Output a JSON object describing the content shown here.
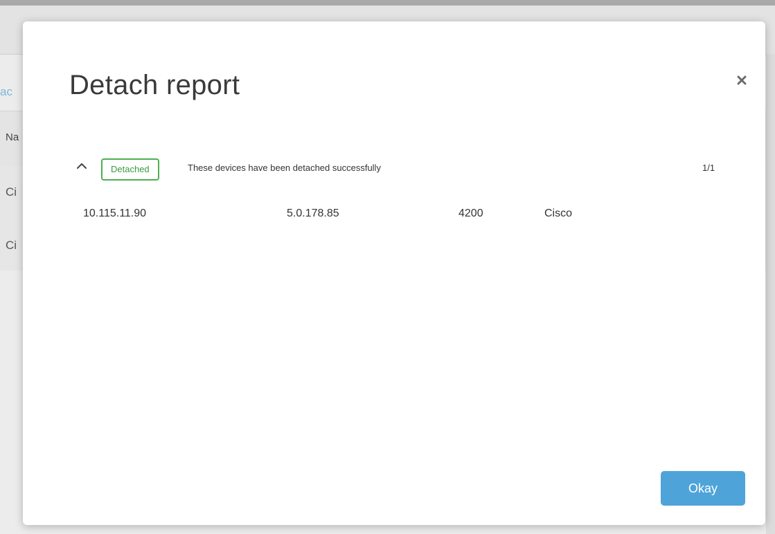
{
  "background": {
    "link_fragment": "ac",
    "column_fragment": "Na",
    "row_fragments": [
      "Ci",
      "Ci"
    ]
  },
  "modal": {
    "title": "Detach report",
    "close_icon": "close-icon",
    "section": {
      "badge": "Detached",
      "message": "These devices have been detached successfully",
      "count": "1/1",
      "rows": [
        {
          "ip": "10.115.11.90",
          "version": "5.0.178.85",
          "model": "4200",
          "vendor": "Cisco"
        }
      ]
    },
    "okay_label": "Okay"
  },
  "colors": {
    "badge_border": "#4caf50",
    "badge_text": "#3a9a40",
    "primary_button": "#4ea4d9"
  }
}
